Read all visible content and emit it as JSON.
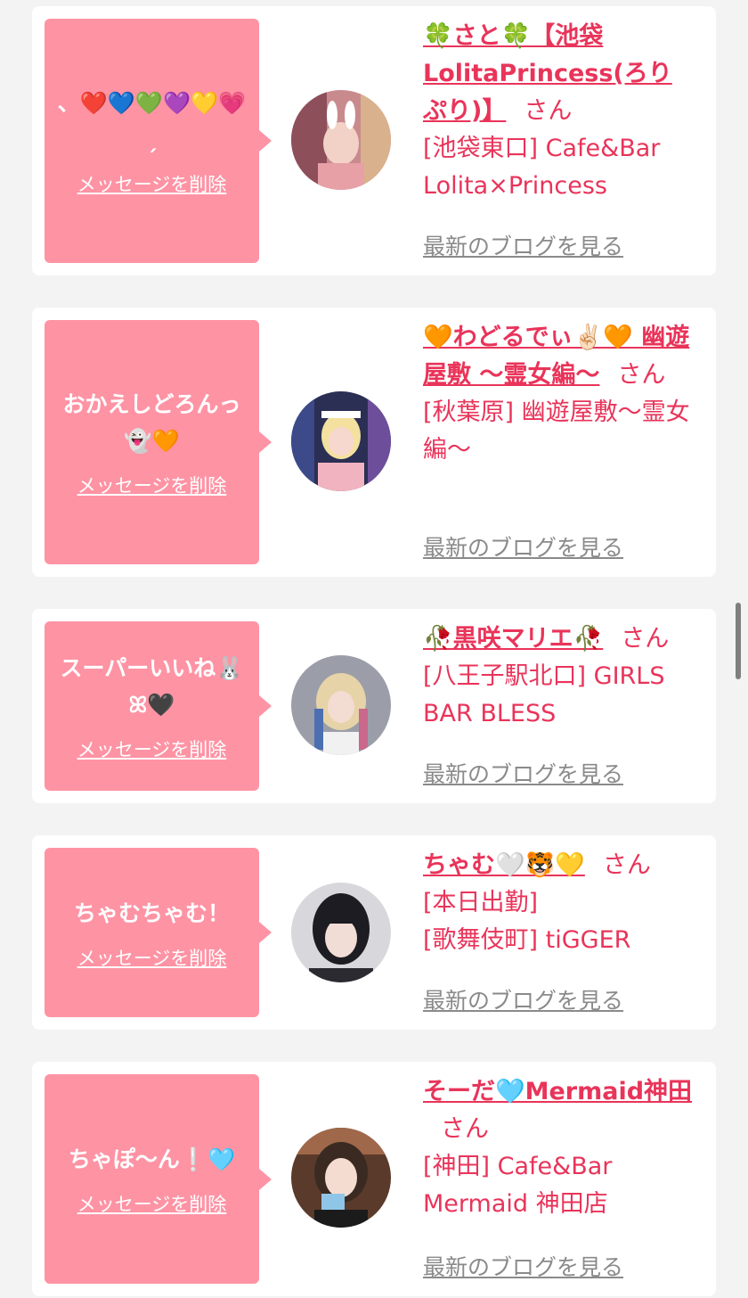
{
  "delete_label": "メッセージを削除",
  "blog_label": "最新のブログを見る",
  "san_label": "さん",
  "colors": {
    "bubble": "#fe93a4",
    "accent": "#e9345a",
    "link_gray": "#8a8a8a"
  },
  "entries": [
    {
      "message": "、❤️💙💚💜💛💗ˏ",
      "name": "🍀さと🍀【池袋LolitaPrincess(ろりぷり)】",
      "shop": "[池袋東口] Cafe&Bar Lolita×Princess",
      "status": ""
    },
    {
      "message": "おかえしどろんっ👻🧡",
      "name": "🧡わどるでぃ✌🏻🧡 幽遊屋敷 〜霊女編〜",
      "shop": "[秋葉原] 幽遊屋敷〜霊女編〜",
      "status": ""
    },
    {
      "message": "スーパーいいね🐰ꕤ🖤",
      "name": "🥀黒咲マリエ🥀",
      "shop": "[八王子駅北口] GIRLS BAR BLESS",
      "status": ""
    },
    {
      "message": "ちゃむちゃむ！",
      "name": "ちゃむ🤍🐯💛",
      "shop": "[歌舞伎町] tiGGER",
      "status": "[本日出勤]"
    },
    {
      "message": "ちゃぽ〜ん❕🩵",
      "name": "そーだ🩵Mermaid神田",
      "shop": "[神田] Cafe&Bar Mermaid 神田店",
      "status": ""
    }
  ]
}
